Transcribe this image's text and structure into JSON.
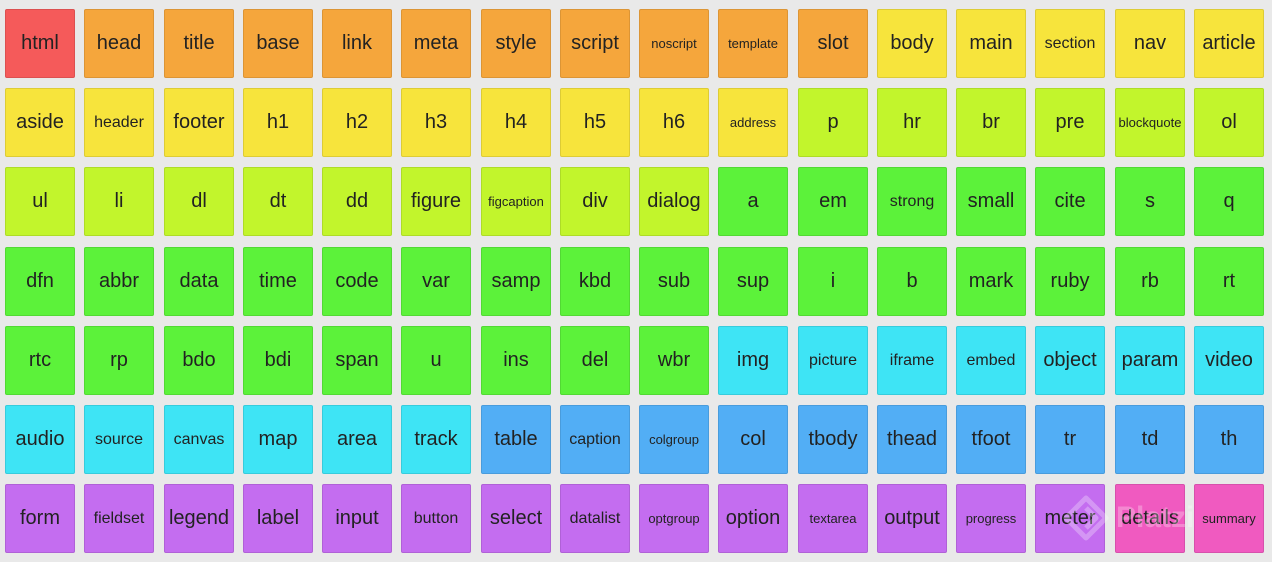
{
  "colors": {
    "red": "#f55a5a",
    "orange": "#f5a63c",
    "yellow": "#f7e43c",
    "yellowgreen": "#c2f52c",
    "green": "#5cf23a",
    "cyan": "#3ee4f5",
    "blue": "#52aef5",
    "purple": "#c46df0",
    "pink": "#f05ac0"
  },
  "tiles": [
    [
      {
        "label": "html",
        "color": "red"
      },
      {
        "label": "head",
        "color": "orange"
      },
      {
        "label": "title",
        "color": "orange"
      },
      {
        "label": "base",
        "color": "orange"
      },
      {
        "label": "link",
        "color": "orange"
      },
      {
        "label": "meta",
        "color": "orange"
      },
      {
        "label": "style",
        "color": "orange"
      },
      {
        "label": "script",
        "color": "orange"
      },
      {
        "label": "noscript",
        "color": "orange",
        "size": "xs"
      },
      {
        "label": "template",
        "color": "orange",
        "size": "xs"
      },
      {
        "label": "slot",
        "color": "orange"
      },
      {
        "label": "body",
        "color": "yellow"
      },
      {
        "label": "main",
        "color": "yellow"
      },
      {
        "label": "section",
        "color": "yellow",
        "size": "sm"
      },
      {
        "label": "nav",
        "color": "yellow"
      },
      {
        "label": "article",
        "color": "yellow"
      }
    ],
    [
      {
        "label": "aside",
        "color": "yellow"
      },
      {
        "label": "header",
        "color": "yellow",
        "size": "sm"
      },
      {
        "label": "footer",
        "color": "yellow"
      },
      {
        "label": "h1",
        "color": "yellow"
      },
      {
        "label": "h2",
        "color": "yellow"
      },
      {
        "label": "h3",
        "color": "yellow"
      },
      {
        "label": "h4",
        "color": "yellow"
      },
      {
        "label": "h5",
        "color": "yellow"
      },
      {
        "label": "h6",
        "color": "yellow"
      },
      {
        "label": "address",
        "color": "yellow",
        "size": "xs"
      },
      {
        "label": "p",
        "color": "yellowgreen"
      },
      {
        "label": "hr",
        "color": "yellowgreen"
      },
      {
        "label": "br",
        "color": "yellowgreen"
      },
      {
        "label": "pre",
        "color": "yellowgreen"
      },
      {
        "label": "blockquote",
        "color": "yellowgreen",
        "size": "xs"
      },
      {
        "label": "ol",
        "color": "yellowgreen"
      }
    ],
    [
      {
        "label": "ul",
        "color": "yellowgreen"
      },
      {
        "label": "li",
        "color": "yellowgreen"
      },
      {
        "label": "dl",
        "color": "yellowgreen"
      },
      {
        "label": "dt",
        "color": "yellowgreen"
      },
      {
        "label": "dd",
        "color": "yellowgreen"
      },
      {
        "label": "figure",
        "color": "yellowgreen"
      },
      {
        "label": "figcaption",
        "color": "yellowgreen",
        "size": "xs"
      },
      {
        "label": "div",
        "color": "yellowgreen"
      },
      {
        "label": "dialog",
        "color": "yellowgreen"
      },
      {
        "label": "a",
        "color": "green"
      },
      {
        "label": "em",
        "color": "green"
      },
      {
        "label": "strong",
        "color": "green",
        "size": "sm"
      },
      {
        "label": "small",
        "color": "green"
      },
      {
        "label": "cite",
        "color": "green"
      },
      {
        "label": "s",
        "color": "green"
      },
      {
        "label": "q",
        "color": "green"
      }
    ],
    [
      {
        "label": "dfn",
        "color": "green"
      },
      {
        "label": "abbr",
        "color": "green"
      },
      {
        "label": "data",
        "color": "green"
      },
      {
        "label": "time",
        "color": "green"
      },
      {
        "label": "code",
        "color": "green"
      },
      {
        "label": "var",
        "color": "green"
      },
      {
        "label": "samp",
        "color": "green"
      },
      {
        "label": "kbd",
        "color": "green"
      },
      {
        "label": "sub",
        "color": "green"
      },
      {
        "label": "sup",
        "color": "green"
      },
      {
        "label": "i",
        "color": "green"
      },
      {
        "label": "b",
        "color": "green"
      },
      {
        "label": "mark",
        "color": "green"
      },
      {
        "label": "ruby",
        "color": "green"
      },
      {
        "label": "rb",
        "color": "green"
      },
      {
        "label": "rt",
        "color": "green"
      }
    ],
    [
      {
        "label": "rtc",
        "color": "green"
      },
      {
        "label": "rp",
        "color": "green"
      },
      {
        "label": "bdo",
        "color": "green"
      },
      {
        "label": "bdi",
        "color": "green"
      },
      {
        "label": "span",
        "color": "green"
      },
      {
        "label": "u",
        "color": "green"
      },
      {
        "label": "ins",
        "color": "green"
      },
      {
        "label": "del",
        "color": "green"
      },
      {
        "label": "wbr",
        "color": "green"
      },
      {
        "label": "img",
        "color": "cyan"
      },
      {
        "label": "picture",
        "color": "cyan",
        "size": "sm"
      },
      {
        "label": "iframe",
        "color": "cyan",
        "size": "sm"
      },
      {
        "label": "embed",
        "color": "cyan",
        "size": "sm"
      },
      {
        "label": "object",
        "color": "cyan"
      },
      {
        "label": "param",
        "color": "cyan"
      },
      {
        "label": "video",
        "color": "cyan"
      }
    ],
    [
      {
        "label": "audio",
        "color": "cyan"
      },
      {
        "label": "source",
        "color": "cyan",
        "size": "sm"
      },
      {
        "label": "canvas",
        "color": "cyan",
        "size": "sm"
      },
      {
        "label": "map",
        "color": "cyan"
      },
      {
        "label": "area",
        "color": "cyan"
      },
      {
        "label": "track",
        "color": "cyan"
      },
      {
        "label": "table",
        "color": "blue"
      },
      {
        "label": "caption",
        "color": "blue",
        "size": "sm"
      },
      {
        "label": "colgroup",
        "color": "blue",
        "size": "xs"
      },
      {
        "label": "col",
        "color": "blue"
      },
      {
        "label": "tbody",
        "color": "blue"
      },
      {
        "label": "thead",
        "color": "blue"
      },
      {
        "label": "tfoot",
        "color": "blue"
      },
      {
        "label": "tr",
        "color": "blue"
      },
      {
        "label": "td",
        "color": "blue"
      },
      {
        "label": "th",
        "color": "blue"
      }
    ],
    [
      {
        "label": "form",
        "color": "purple"
      },
      {
        "label": "fieldset",
        "color": "purple",
        "size": "sm"
      },
      {
        "label": "legend",
        "color": "purple"
      },
      {
        "label": "label",
        "color": "purple"
      },
      {
        "label": "input",
        "color": "purple"
      },
      {
        "label": "button",
        "color": "purple",
        "size": "sm"
      },
      {
        "label": "select",
        "color": "purple"
      },
      {
        "label": "datalist",
        "color": "purple",
        "size": "sm"
      },
      {
        "label": "optgroup",
        "color": "purple",
        "size": "xs"
      },
      {
        "label": "option",
        "color": "purple"
      },
      {
        "label": "textarea",
        "color": "purple",
        "size": "xs"
      },
      {
        "label": "output",
        "color": "purple"
      },
      {
        "label": "progress",
        "color": "purple",
        "size": "xs"
      },
      {
        "label": "meter",
        "color": "purple"
      },
      {
        "label": "details",
        "color": "pink"
      },
      {
        "label": "summary",
        "color": "pink",
        "size": "xs"
      }
    ]
  ],
  "watermark": {
    "text": "Platzi"
  }
}
